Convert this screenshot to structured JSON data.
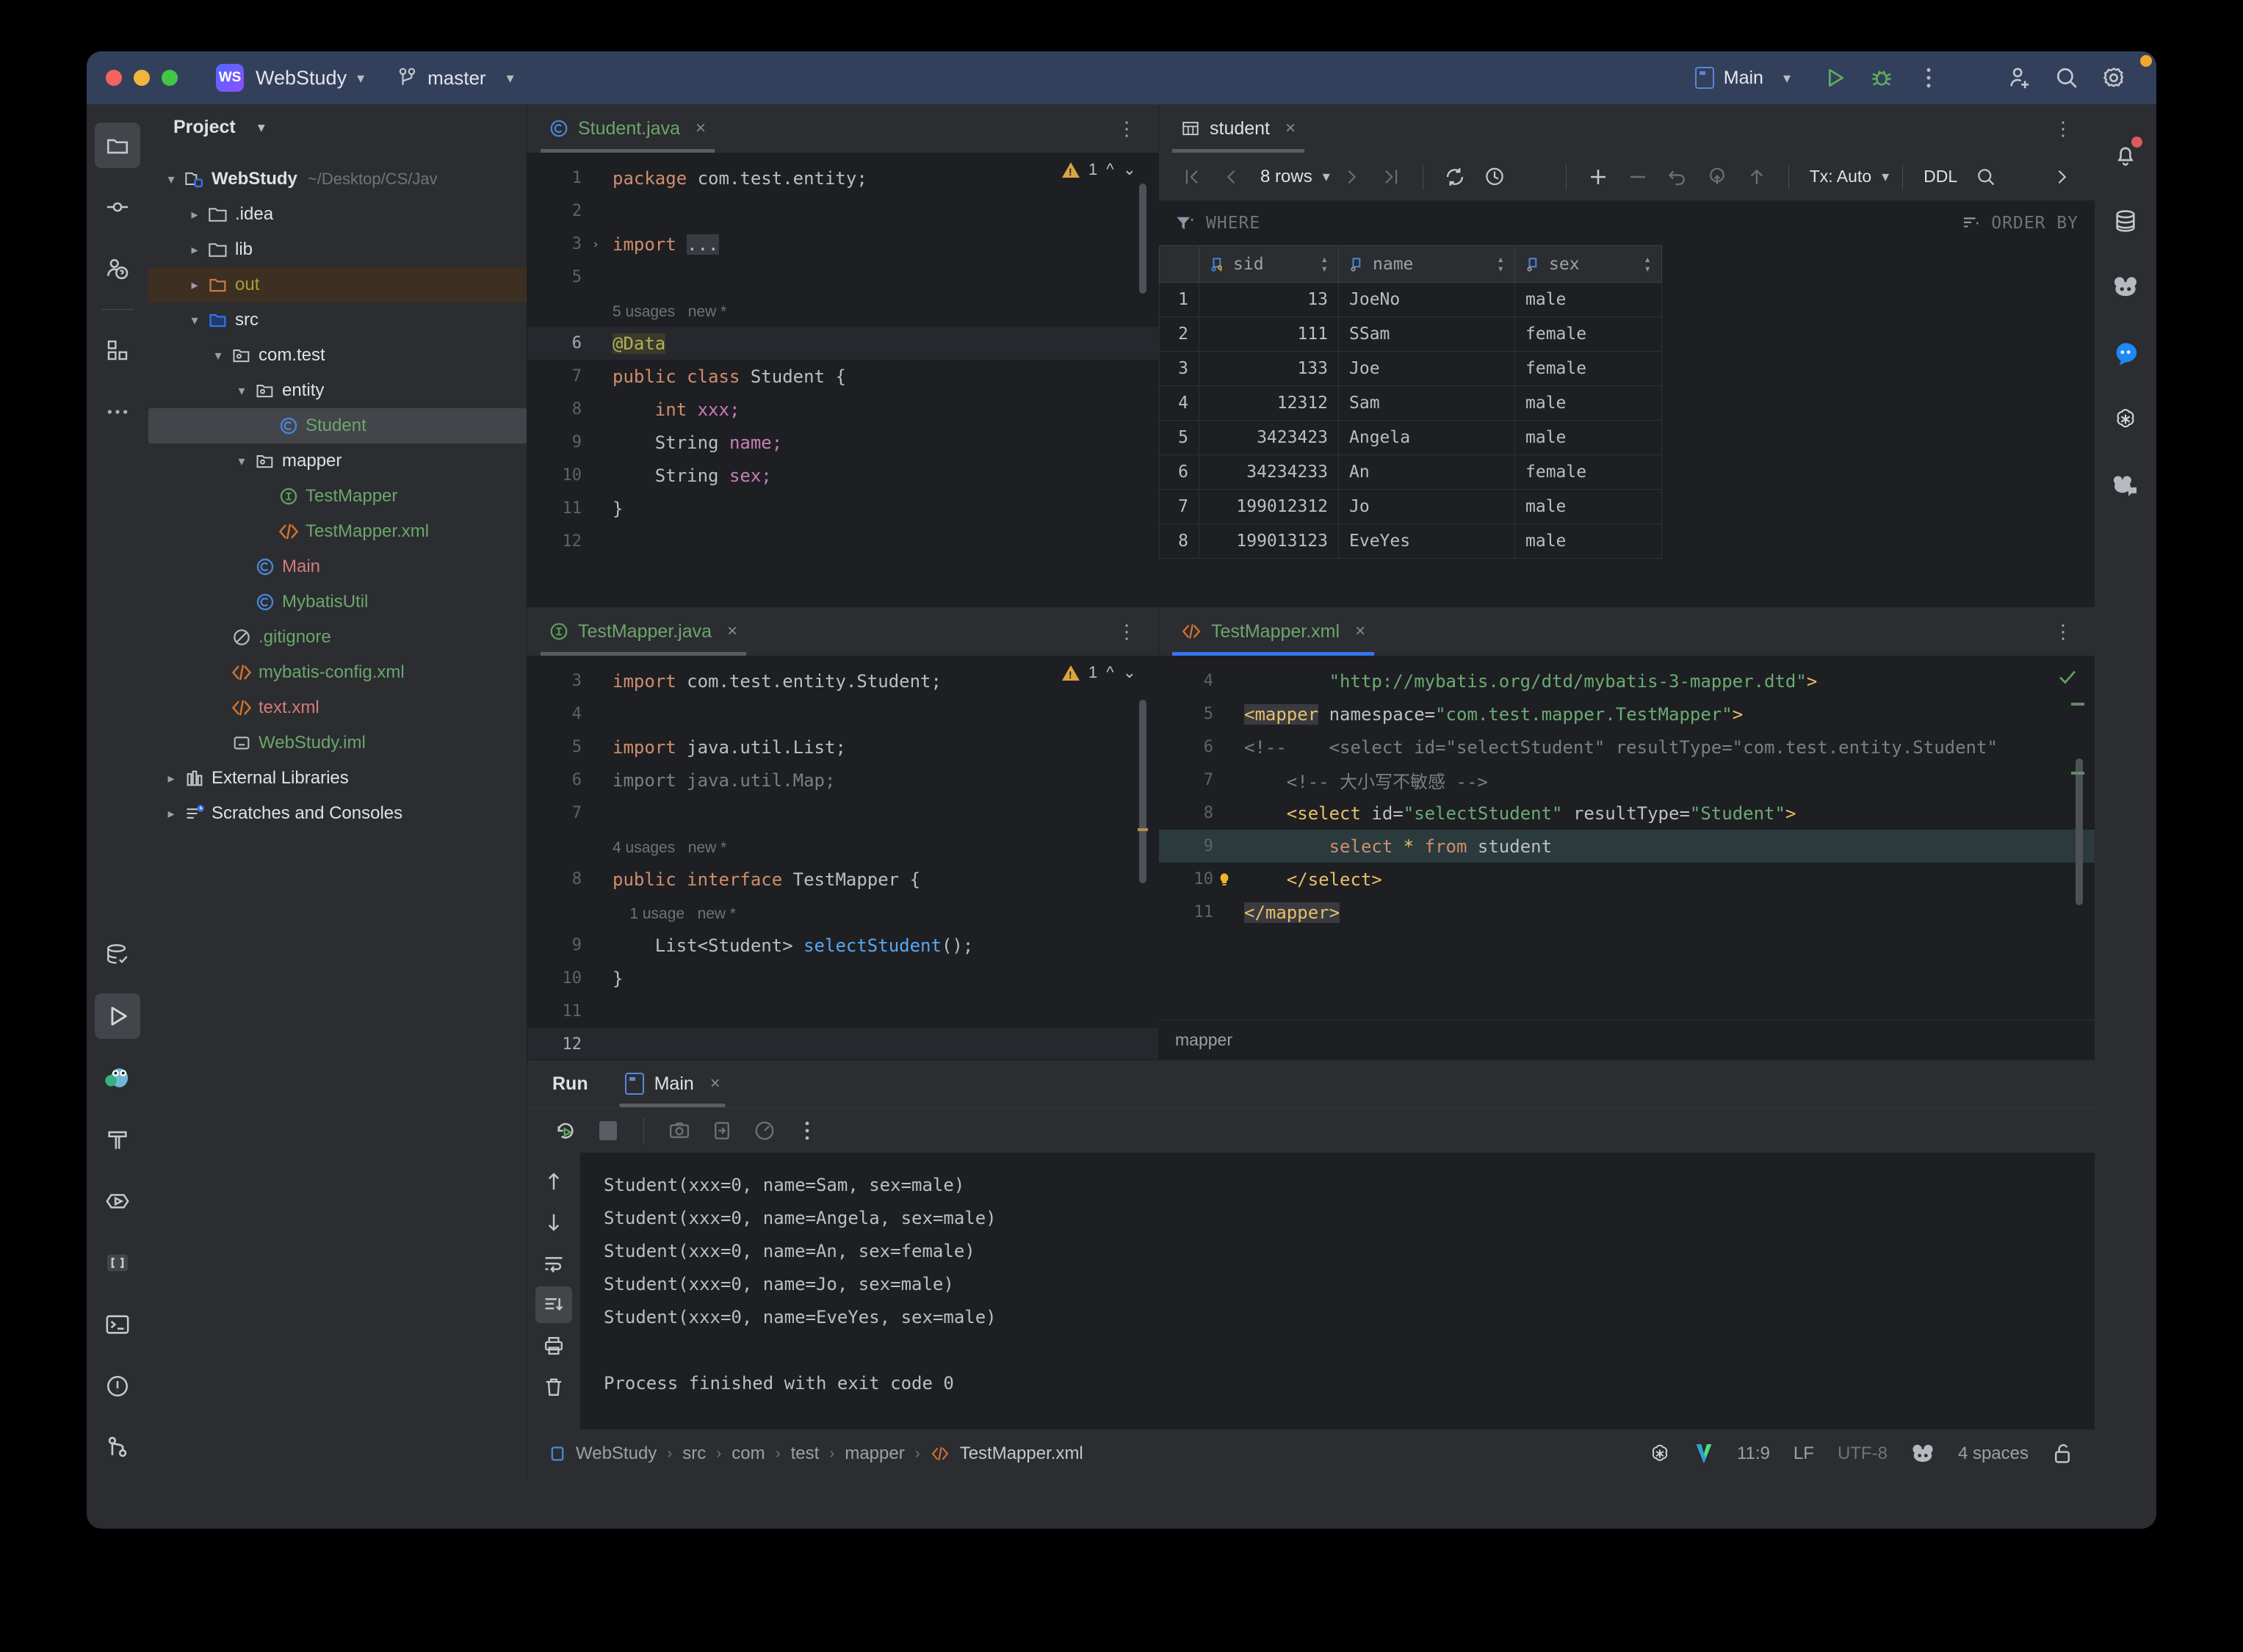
{
  "window": {
    "project_initials": "WS",
    "project_name": "WebStudy",
    "branch": "master",
    "run_config": "Main"
  },
  "project_panel": {
    "title": "Project",
    "tree": [
      {
        "label": "WebStudy",
        "path": "~/Desktop/CS/Jav",
        "icon": "module-folder-icon",
        "indent": 0,
        "expanded": true,
        "color": "white",
        "bold": true
      },
      {
        "label": ".idea",
        "icon": "folder-icon",
        "indent": 1,
        "expanded": false,
        "color": "white"
      },
      {
        "label": "lib",
        "icon": "folder-icon",
        "indent": 1,
        "expanded": false,
        "color": "white"
      },
      {
        "label": "out",
        "icon": "folder-excluded-icon",
        "indent": 1,
        "expanded": false,
        "color": "olive",
        "selected": "out"
      },
      {
        "label": "src",
        "icon": "source-folder-icon",
        "indent": 1,
        "expanded": true,
        "color": "white"
      },
      {
        "label": "com.test",
        "icon": "package-icon",
        "indent": 2,
        "expanded": true,
        "color": "white"
      },
      {
        "label": "entity",
        "icon": "package-icon",
        "indent": 3,
        "expanded": true,
        "color": "white"
      },
      {
        "label": "Student",
        "icon": "class-icon",
        "indent": 4,
        "color": "green",
        "selected": "gray"
      },
      {
        "label": "mapper",
        "icon": "package-icon",
        "indent": 3,
        "expanded": true,
        "color": "white"
      },
      {
        "label": "TestMapper",
        "icon": "interface-icon",
        "indent": 4,
        "color": "green"
      },
      {
        "label": "TestMapper.xml",
        "icon": "xml-icon",
        "indent": 4,
        "color": "green"
      },
      {
        "label": "Main",
        "icon": "class-icon",
        "indent": 3,
        "color": "red"
      },
      {
        "label": "MybatisUtil",
        "icon": "class-icon",
        "indent": 3,
        "color": "green"
      },
      {
        "label": ".gitignore",
        "icon": "gitignore-icon",
        "indent": 2,
        "color": "green"
      },
      {
        "label": "mybatis-config.xml",
        "icon": "xml-icon",
        "indent": 2,
        "color": "green"
      },
      {
        "label": "text.xml",
        "icon": "xml-icon",
        "indent": 2,
        "color": "red"
      },
      {
        "label": "WebStudy.iml",
        "icon": "iml-icon",
        "indent": 2,
        "color": "green"
      },
      {
        "label": "External Libraries",
        "icon": "libraries-icon",
        "indent": 0,
        "expanded": false,
        "color": "white"
      },
      {
        "label": "Scratches and Consoles",
        "icon": "scratches-icon",
        "indent": 0,
        "expanded": false,
        "color": "white"
      }
    ]
  },
  "editor_student": {
    "tab_label": "Student.java",
    "tab_icon": "class-icon",
    "warning_count": "1",
    "lines": [
      {
        "num": "1",
        "segs": [
          {
            "t": "package ",
            "c": "kw"
          },
          {
            "t": "com.test.entity;",
            "c": "plain"
          }
        ]
      },
      {
        "num": "2",
        "segs": []
      },
      {
        "num": "3",
        "fold": "›",
        "segs": [
          {
            "t": "import ",
            "c": "kw"
          },
          {
            "t": "...",
            "c": "plain",
            "bg": "gray"
          }
        ]
      },
      {
        "num": "5",
        "segs": []
      },
      {
        "num": "",
        "hintline": "5 usages   new *"
      },
      {
        "num": "6",
        "current": true,
        "segs": [
          {
            "t": "@Data",
            "c": "anno",
            "bg": "anno"
          }
        ]
      },
      {
        "num": "7",
        "segs": [
          {
            "t": "public class ",
            "c": "kw"
          },
          {
            "t": "Student {",
            "c": "plain"
          }
        ]
      },
      {
        "num": "8",
        "segs": [
          {
            "t": "    int ",
            "c": "kw"
          },
          {
            "t": "xxx;",
            "c": "fld"
          }
        ]
      },
      {
        "num": "9",
        "segs": [
          {
            "t": "    String ",
            "c": "plain"
          },
          {
            "t": "name;",
            "c": "fld"
          }
        ]
      },
      {
        "num": "10",
        "segs": [
          {
            "t": "    String ",
            "c": "plain"
          },
          {
            "t": "sex;",
            "c": "fld"
          }
        ]
      },
      {
        "num": "11",
        "segs": [
          {
            "t": "}",
            "c": "plain"
          }
        ]
      },
      {
        "num": "12",
        "segs": []
      }
    ]
  },
  "editor_testmapper_java": {
    "tab_label": "TestMapper.java",
    "tab_icon": "interface-icon",
    "warning_count": "1",
    "lines": [
      {
        "num": "3",
        "segs": [
          {
            "t": "import ",
            "c": "kw"
          },
          {
            "t": "com.test.entity.Student;",
            "c": "plain"
          }
        ]
      },
      {
        "num": "4",
        "segs": []
      },
      {
        "num": "5",
        "segs": [
          {
            "t": "import ",
            "c": "kw"
          },
          {
            "t": "java.util.List;",
            "c": "plain"
          }
        ]
      },
      {
        "num": "6",
        "segs": [
          {
            "t": "import java.util.Map;",
            "c": "cmt"
          }
        ]
      },
      {
        "num": "7",
        "segs": []
      },
      {
        "num": "",
        "hintline": "4 usages   new *"
      },
      {
        "num": "8",
        "segs": [
          {
            "t": "public interface ",
            "c": "kw"
          },
          {
            "t": "TestMapper {",
            "c": "plain"
          }
        ]
      },
      {
        "num": "",
        "hintline": "    1 usage   new *"
      },
      {
        "num": "9",
        "segs": [
          {
            "t": "    List<Student> ",
            "c": "plain"
          },
          {
            "t": "selectStudent",
            "c": "mth"
          },
          {
            "t": "();",
            "c": "plain"
          }
        ]
      },
      {
        "num": "10",
        "segs": [
          {
            "t": "}",
            "c": "plain"
          }
        ]
      },
      {
        "num": "11",
        "segs": []
      },
      {
        "num": "12",
        "current": true,
        "segs": []
      }
    ]
  },
  "db_panel": {
    "tab_label": "student",
    "tab_icon": "table-icon",
    "rows_label": "8 rows",
    "tx_label": "Tx: Auto",
    "ddl_label": "DDL",
    "where_label": "WHERE",
    "order_by_label": "ORDER BY",
    "columns": [
      "sid",
      "name",
      "sex"
    ],
    "column_icons": [
      "pk-column-icon",
      "column-icon",
      "column-icon"
    ],
    "rows": [
      {
        "n": "1",
        "sid": "13",
        "name": "JoeNo",
        "sex": "male"
      },
      {
        "n": "2",
        "sid": "111",
        "name": "SSam",
        "sex": "female"
      },
      {
        "n": "3",
        "sid": "133",
        "name": "Joe",
        "sex": "female"
      },
      {
        "n": "4",
        "sid": "12312",
        "name": "Sam",
        "sex": "male"
      },
      {
        "n": "5",
        "sid": "3423423",
        "name": "Angela",
        "sex": "male"
      },
      {
        "n": "6",
        "sid": "34234233",
        "name": "An",
        "sex": "female"
      },
      {
        "n": "7",
        "sid": "199012312",
        "name": "Jo",
        "sex": "male"
      },
      {
        "n": "8",
        "sid": "199013123",
        "name": "EveYes",
        "sex": "male"
      }
    ]
  },
  "editor_testmapper_xml": {
    "tab_label": "TestMapper.xml",
    "tab_icon": "xml-icon",
    "breadcrumb": "mapper",
    "lines": [
      {
        "num": "4",
        "segs": [
          {
            "t": "        \"http://mybatis.org/dtd/mybatis-3-mapper.dtd\"",
            "c": "str"
          },
          {
            "t": ">",
            "c": "tag"
          }
        ]
      },
      {
        "num": "5",
        "segs": [
          {
            "t": "<mapper",
            "c": "tag",
            "bg": "gray"
          },
          {
            "t": " namespace=",
            "c": "attr"
          },
          {
            "t": "\"com.test.mapper.TestMapper\"",
            "c": "str"
          },
          {
            "t": ">",
            "c": "tag"
          }
        ]
      },
      {
        "num": "6",
        "segs": [
          {
            "t": "<!--    <select id=\"selectStudent\" resultType=\"com.test.entity.Student\"",
            "c": "cmt"
          }
        ]
      },
      {
        "num": "7",
        "segs": [
          {
            "t": "    <!-- 大小写不敏感 -->",
            "c": "cmt"
          }
        ]
      },
      {
        "num": "8",
        "segs": [
          {
            "t": "    <select ",
            "c": "tag"
          },
          {
            "t": "id=",
            "c": "attr"
          },
          {
            "t": "\"selectStudent\"",
            "c": "str"
          },
          {
            "t": " resultType=",
            "c": "attr"
          },
          {
            "t": "\"Student\"",
            "c": "str"
          },
          {
            "t": ">",
            "c": "tag"
          }
        ]
      },
      {
        "num": "9",
        "highlight": true,
        "segs": [
          {
            "t": "        select ",
            "c": "kw"
          },
          {
            "t": "* ",
            "c": "tag"
          },
          {
            "t": "from ",
            "c": "kw"
          },
          {
            "t": "student",
            "c": "plain"
          }
        ]
      },
      {
        "num": "10",
        "bulb": true,
        "segs": [
          {
            "t": "    </select>",
            "c": "tag"
          }
        ]
      },
      {
        "num": "11",
        "segs": [
          {
            "t": "</mapper>",
            "c": "tag",
            "bg": "gray"
          }
        ]
      }
    ]
  },
  "run_panel": {
    "title": "Run",
    "tab_label": "Main",
    "console_lines": [
      "Student(xxx=0, name=Sam, sex=male)",
      "Student(xxx=0, name=Angela, sex=male)",
      "Student(xxx=0, name=An, sex=female)",
      "Student(xxx=0, name=Jo, sex=male)",
      "Student(xxx=0, name=EveYes, sex=male)",
      "",
      "Process finished with exit code 0"
    ]
  },
  "status_bar": {
    "breadcrumbs": [
      "WebStudy",
      "src",
      "com",
      "test",
      "mapper",
      "TestMapper.xml"
    ],
    "caret": "11:9",
    "line_separator": "LF",
    "encoding": "UTF-8",
    "indent": "4 spaces"
  },
  "colors": {
    "accent_blue": "#3574f0",
    "title_bar": "#32405c",
    "editor_bg": "#1e1f22",
    "panel_bg": "#2b2d30",
    "green_text": "#6ca66c",
    "warning_yellow": "#d9a343"
  }
}
